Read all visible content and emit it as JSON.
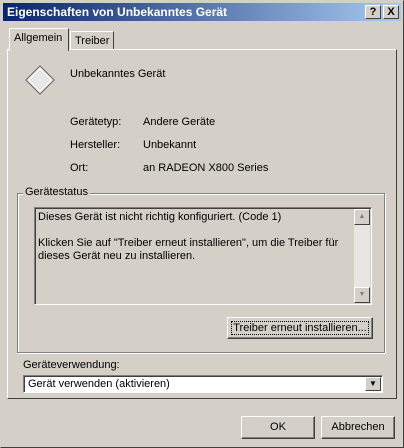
{
  "window": {
    "title": "Eigenschaften von Unbekanntes Gerät",
    "help_button": "?",
    "close_button": "X"
  },
  "tabs": [
    {
      "label": "Allgemein",
      "active": true
    },
    {
      "label": "Treiber",
      "active": false
    }
  ],
  "device": {
    "name": "Unbekanntes Gerät",
    "icon": "unknown-device-diamond-icon",
    "properties": [
      {
        "label": "Gerätetyp:",
        "value": "Andere Geräte"
      },
      {
        "label": "Hersteller:",
        "value": "Unbekannt"
      },
      {
        "label": "Ort:",
        "value": "an RADEON X800 Series"
      }
    ]
  },
  "status": {
    "group_label": "Gerätestatus",
    "line1": "Dieses Gerät ist nicht richtig konfiguriert. (Code 1)",
    "line2": "Klicken Sie auf \"Treiber erneut installieren\", um die Treiber für dieses Gerät neu zu installieren.",
    "reinstall_button": "Treiber erneut installieren..."
  },
  "usage": {
    "label": "Geräteverwendung:",
    "selected": "Gerät verwenden (aktivieren)"
  },
  "footer": {
    "ok": "OK",
    "cancel": "Abbrechen"
  }
}
